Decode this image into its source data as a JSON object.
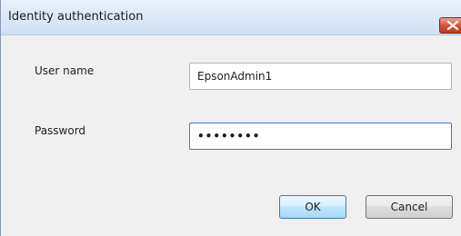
{
  "window": {
    "title": "Identity authentication",
    "close_icon": "close-icon"
  },
  "form": {
    "user_name_label": "User name",
    "user_name_value": "EpsonAdmin1",
    "password_label": "Password",
    "password_masked": "••••••••"
  },
  "buttons": {
    "ok_label": "OK",
    "cancel_label": "Cancel"
  }
}
